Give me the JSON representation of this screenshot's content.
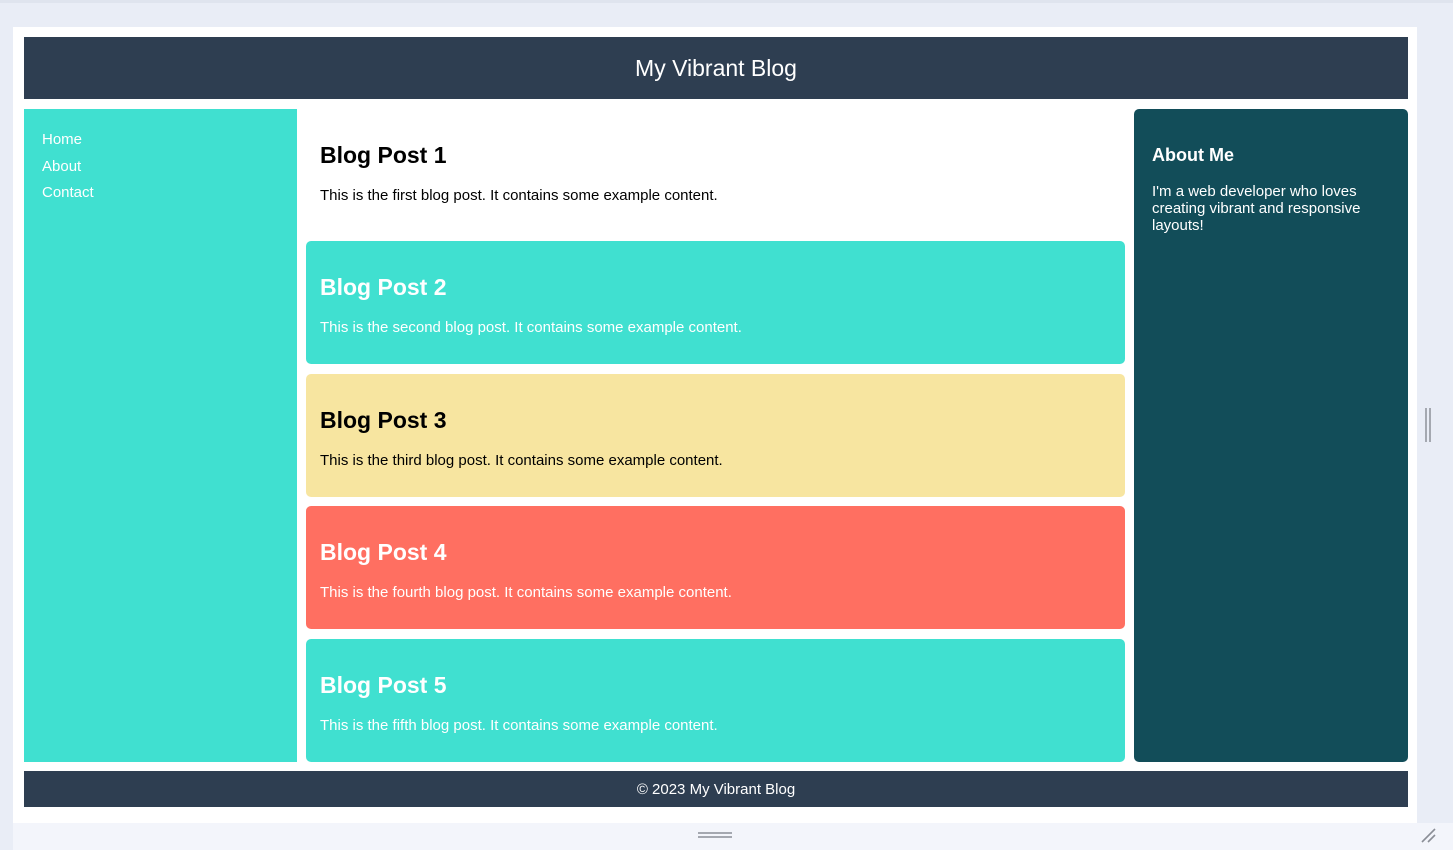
{
  "header": {
    "title": "My Vibrant Blog"
  },
  "nav": {
    "items": [
      {
        "label": "Home"
      },
      {
        "label": "About"
      },
      {
        "label": "Contact"
      }
    ]
  },
  "posts": [
    {
      "title": "Blog Post 1",
      "body": "This is the first blog post. It contains some example content."
    },
    {
      "title": "Blog Post 2",
      "body": "This is the second blog post. It contains some example content."
    },
    {
      "title": "Blog Post 3",
      "body": "This is the third blog post. It contains some example content."
    },
    {
      "title": "Blog Post 4",
      "body": "This is the fourth blog post. It contains some example content."
    },
    {
      "title": "Blog Post 5",
      "body": "This is the fifth blog post. It contains some example content."
    }
  ],
  "aside": {
    "title": "About Me",
    "body": "I'm a web developer who loves creating vibrant and responsive layouts!"
  },
  "footer": {
    "text": "© 2023 My Vibrant Blog"
  },
  "colors": {
    "header_bg": "#2e3e51",
    "turquoise": "#40e0d0",
    "sand": "#f7e5a0",
    "coral": "#ff6f61",
    "aside_bg": "#124d59"
  },
  "icons": {
    "vertical_drag_handle": "vertical-resize-handle-icon",
    "horizontal_drag_handle": "horizontal-resize-handle-icon",
    "corner_resize": "corner-resize-icon"
  }
}
